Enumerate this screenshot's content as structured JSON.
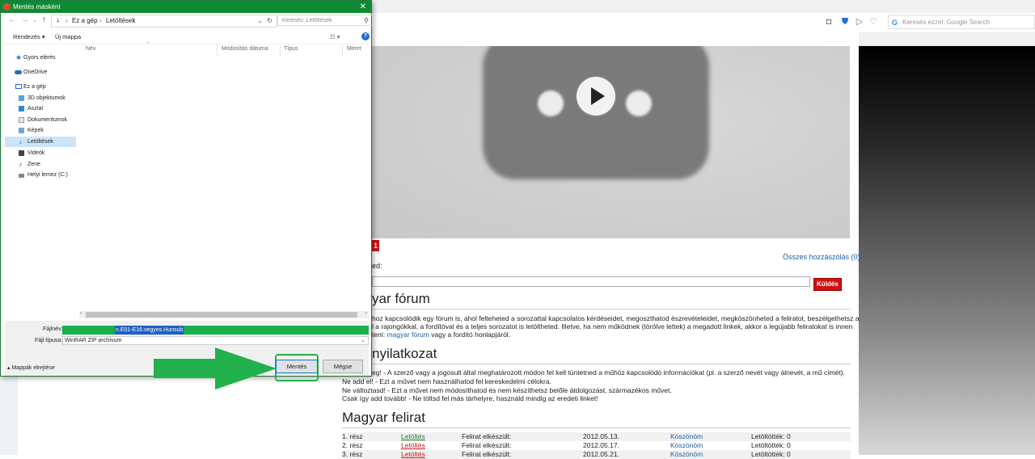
{
  "browser": {
    "search_placeholder": "Keresés ezzel: Google Search",
    "search_icon_letter": "G"
  },
  "page": {
    "badge_count": "1",
    "all_comments": "Összes hozzászólás (0)",
    "comment_label_partial": "ed:",
    "send_button": "Küldés",
    "forum_title": "yar fórum",
    "forum_text_1": "hoz kapcsolódik egy fórum is, ahol felteheted a sorozattal kapcsolatos kérdéseidet, megoszthatod észrevételeidet, megköszönheted a feliratot, beszélgethetsz a",
    "forum_text_2": "l a rajongókkal, a fordítóval és a teljes sorozatot is letöltheted. Illetve, ha nem működnek (törölve lettek) a megadott linkek, akkor a legújabb feliratokat is innen",
    "forum_text_3_prefix": "teni: ",
    "forum_link": "magyar fórum",
    "forum_text_3_suffix": " vagy a fordító honlapjáról.",
    "disclaimer_title": "nyilatkozat",
    "disclaimer_1": "eg! - A szerző vagy a jogosult által meghatározott módon fel kell tüntetned a műhöz kapcsolódó információkat (pl. a szerző nevét vagy álnevét, a mű címét).",
    "disclaimer_2": "Ne add el! - Ezt a művet nem használhatod fel kereskedelmi célokra.",
    "disclaimer_3": "Ne változtasd! - Ezt a művet nem módosíthatod és nem készíthetsz belőle átdolgozást, származékos művet.",
    "disclaimer_4": "Csak így add tovább! - Ne töltsd fel más tárhelyre, használd mindig az eredeti linket!",
    "subs_title": "Magyar felirat",
    "subtitles": [
      {
        "part": "1. rész",
        "download": "Letöltés",
        "status": "Felirat elkészült:",
        "date": "2012.05.13.",
        "thanks": "Köszönöm",
        "downloads": "Letöltötték: 0"
      },
      {
        "part": "2. rész",
        "download": "Letöltés",
        "status": "Felirat elkészült:",
        "date": "2012.05.17.",
        "thanks": "Köszönöm",
        "downloads": "Letöltötték: 0"
      },
      {
        "part": "3. rész",
        "download": "Letöltés",
        "status": "Felirat elkészült:",
        "date": "2012.05.21.",
        "thanks": "Köszönöm",
        "downloads": "Letöltötték: 0"
      }
    ]
  },
  "dialog": {
    "title": "Mentés másként",
    "close": "✕",
    "breadcrumb": [
      "Ez a gép",
      "Letöltések"
    ],
    "search_placeholder": "Keresés: Letöltések",
    "organize": "Rendezés",
    "new_folder": "Új mappa",
    "nav_items": [
      {
        "label": "Gyors elérés",
        "icon": "star-icon"
      },
      {
        "label": "OneDrive",
        "icon": "cloud-icon"
      },
      {
        "label": "Ez a gép",
        "icon": "computer-icon"
      },
      {
        "label": "3D objektumok",
        "icon": "cube-icon"
      },
      {
        "label": "Asztal",
        "icon": "desktop-icon"
      },
      {
        "label": "Dokumentumok",
        "icon": "document-icon"
      },
      {
        "label": "Képek",
        "icon": "image-icon"
      },
      {
        "label": "Letöltések",
        "icon": "download-icon"
      },
      {
        "label": "Videók",
        "icon": "video-icon"
      },
      {
        "label": "Zene",
        "icon": "music-icon"
      },
      {
        "label": "Helyi lemez (C:)",
        "icon": "disk-icon"
      }
    ],
    "columns": [
      "Név",
      "Módosítás dátuma",
      "Típus",
      "Méret"
    ],
    "filename_label": "Fájlnév:",
    "filename_value": "n.E01-E16.vegyes.Hunsub",
    "filetype_label": "Fájl típusa:",
    "filetype_value": "WinRAR ZIP archívum",
    "hide_folders": "Mappák elrejtése",
    "save_button": "Mentés",
    "cancel_button": "Mégse"
  },
  "colors": {
    "titlebar": "#0e8a32",
    "highlight_green": "#22b14c",
    "filename_bg": "#1aae4f",
    "send_red": "#cc1111",
    "link_blue": "#1a5fa8"
  }
}
